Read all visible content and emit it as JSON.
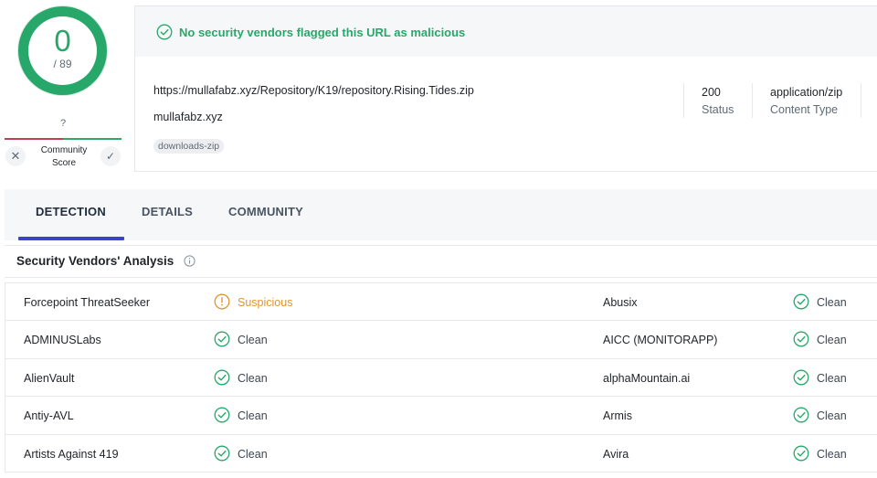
{
  "score": {
    "value": "0",
    "total": "/ 89"
  },
  "community": {
    "value": "?",
    "label": "Community Score"
  },
  "banner": {
    "text": "No security vendors flagged this URL as malicious"
  },
  "url": {
    "full": "https://mullafabz.xyz/Repository/K19/repository.Rising.Tides.zip",
    "domain": "mullafabz.xyz",
    "tag": "downloads-zip"
  },
  "stats": [
    {
      "value": "200",
      "label": "Status"
    },
    {
      "value": "application/zip",
      "label": "Content Type"
    }
  ],
  "tabs": [
    {
      "label": "DETECTION",
      "active": true
    },
    {
      "label": "DETAILS",
      "active": false
    },
    {
      "label": "COMMUNITY",
      "active": false
    }
  ],
  "section": {
    "title": "Security Vendors' Analysis"
  },
  "vendors": [
    {
      "left": {
        "name": "Forcepoint ThreatSeeker",
        "result": "Suspicious",
        "status": "suspicious"
      },
      "right": {
        "name": "Abusix",
        "result": "Clean",
        "status": "clean"
      }
    },
    {
      "left": {
        "name": "ADMINUSLabs",
        "result": "Clean",
        "status": "clean"
      },
      "right": {
        "name": "AICC (MONITORAPP)",
        "result": "Clean",
        "status": "clean"
      }
    },
    {
      "left": {
        "name": "AlienVault",
        "result": "Clean",
        "status": "clean"
      },
      "right": {
        "name": "alphaMountain.ai",
        "result": "Clean",
        "status": "clean"
      }
    },
    {
      "left": {
        "name": "Antiy-AVL",
        "result": "Clean",
        "status": "clean"
      },
      "right": {
        "name": "Armis",
        "result": "Clean",
        "status": "clean"
      }
    },
    {
      "left": {
        "name": "Artists Against 419",
        "result": "Clean",
        "status": "clean"
      },
      "right": {
        "name": "Avira",
        "result": "Clean",
        "status": "clean"
      }
    }
  ],
  "colors": {
    "clean": "#27a86a",
    "suspicious": "#e0962f",
    "accent": "#3b45c4"
  },
  "icons": {
    "clean": "check-circle-icon",
    "suspicious": "info-circle-icon"
  }
}
